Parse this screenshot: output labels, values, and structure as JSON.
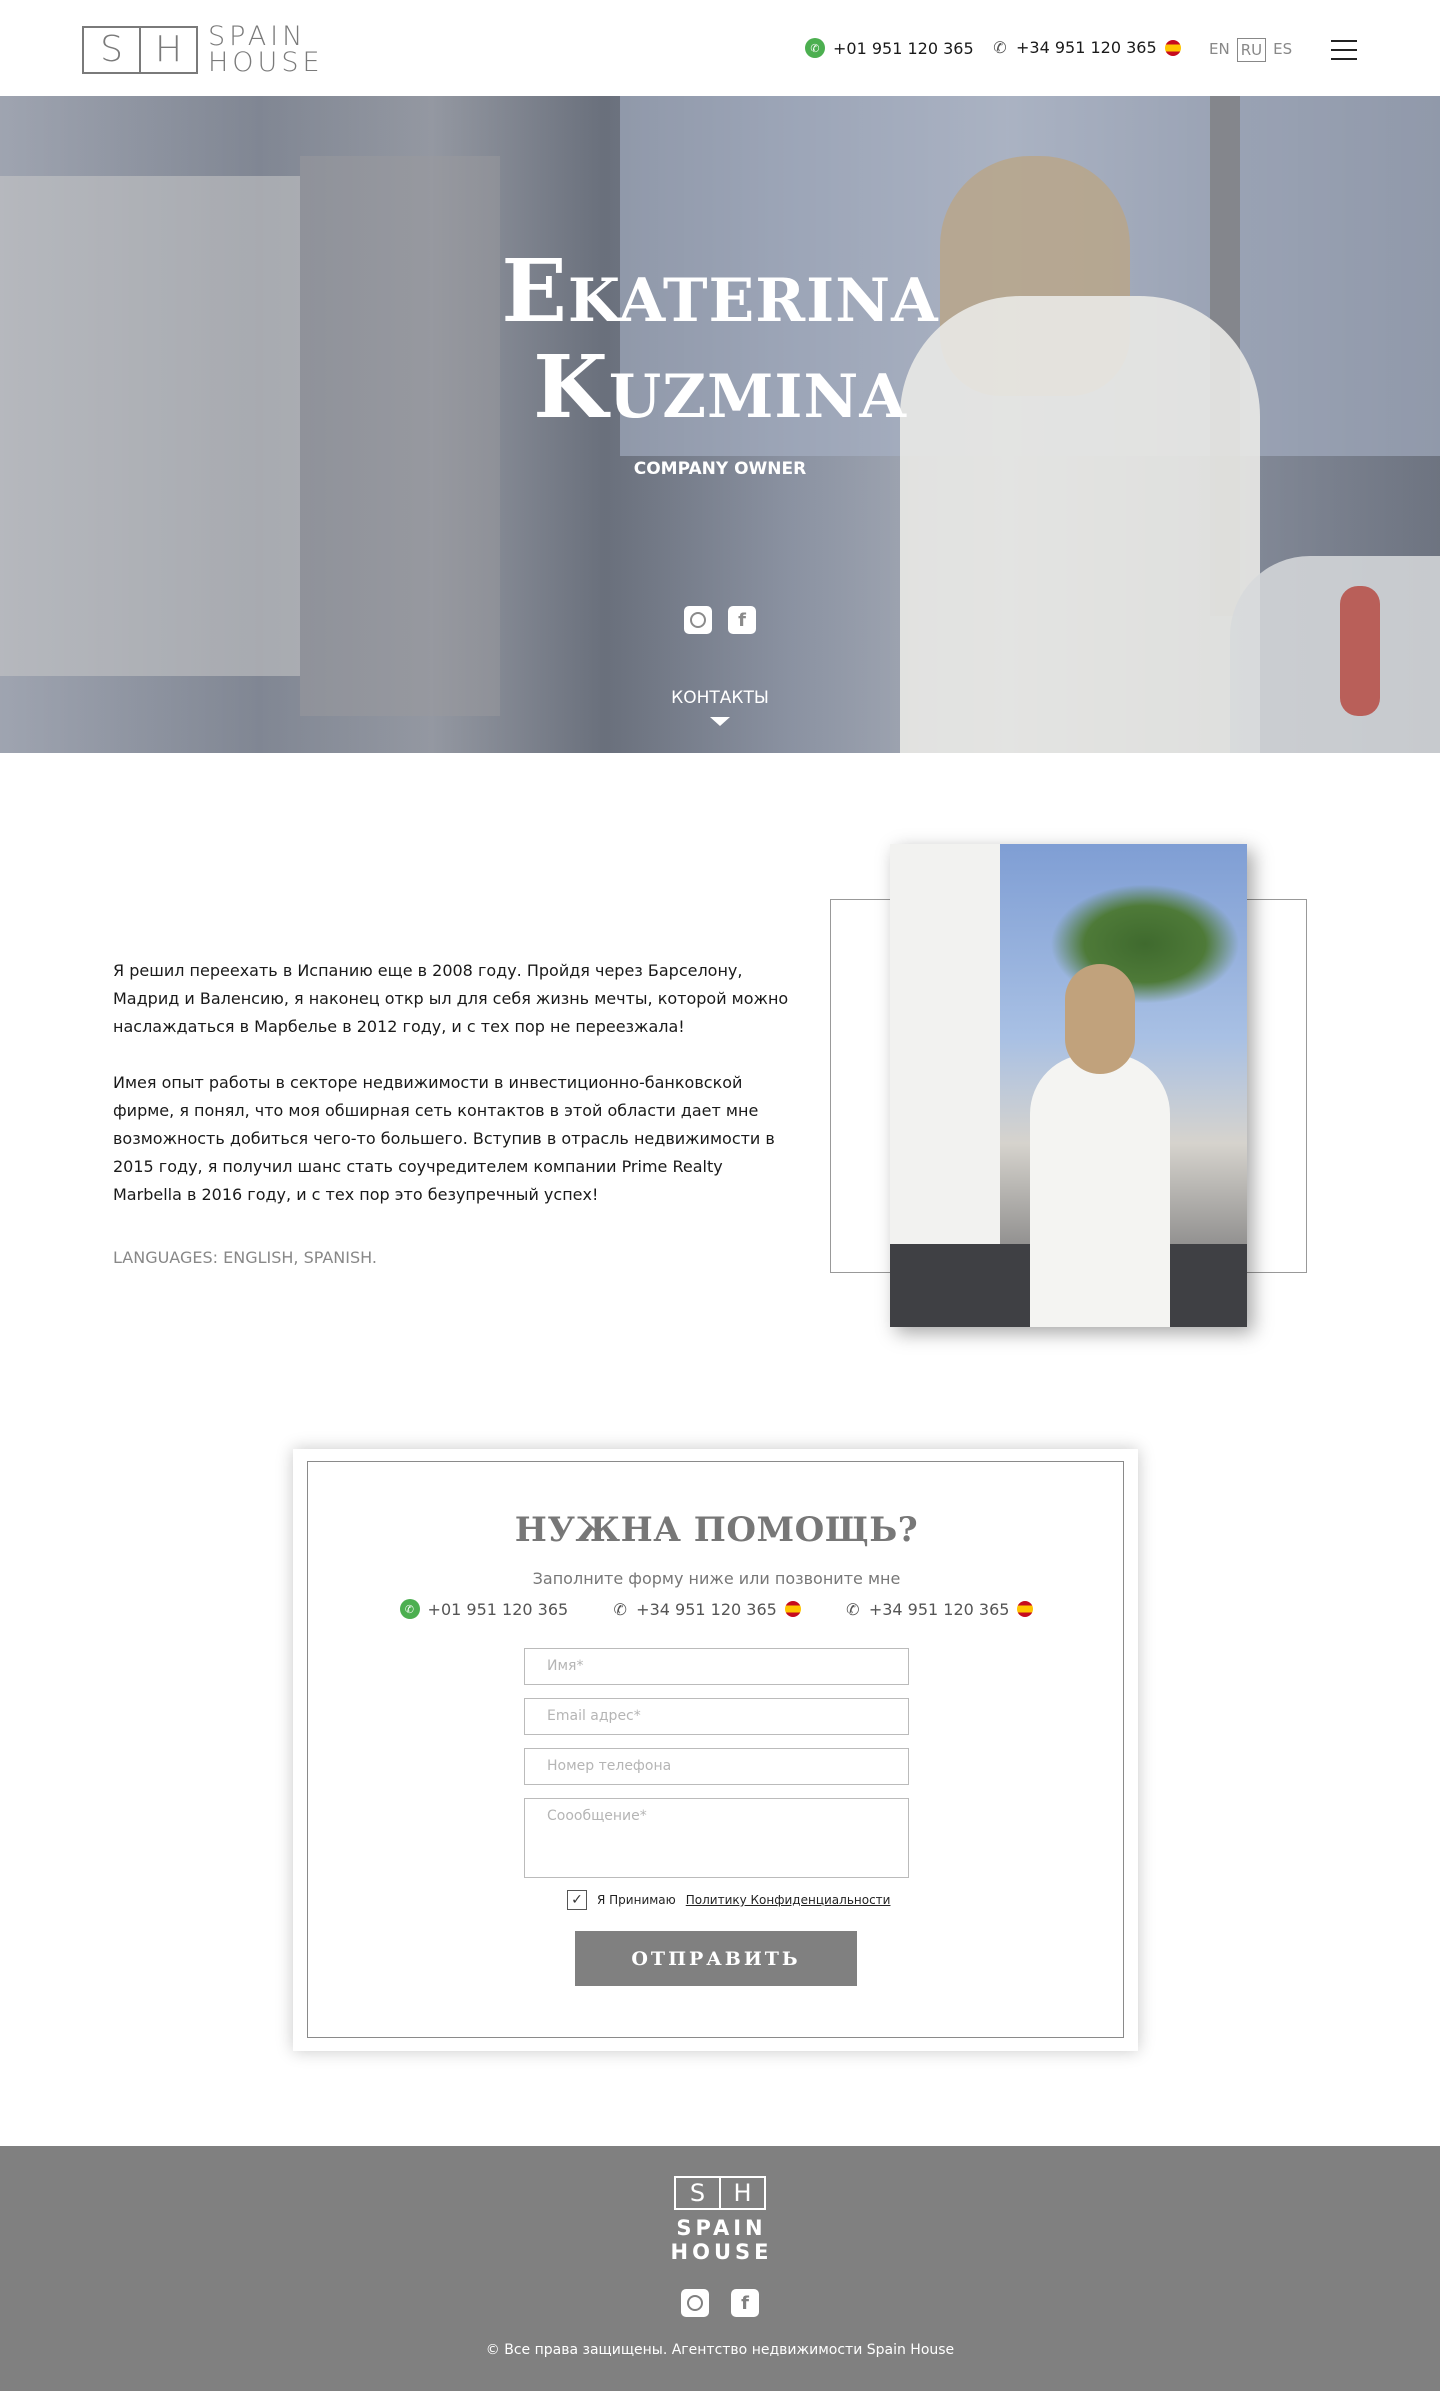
{
  "header": {
    "logo": {
      "letter_left": "S",
      "letter_right": "H",
      "word1": "SPAIN",
      "word2": "HOUSE"
    },
    "phone_whatsapp": "+01 951 120 365",
    "phone_spain": "+34 951 120 365",
    "languages": [
      "EN",
      "RU",
      "ES"
    ],
    "active_language": "RU"
  },
  "hero": {
    "first_name": "Ekaterina",
    "last_name": "Kuzmina",
    "role": "COMPANY OWNER",
    "contacts_label": "КОНТАКТЫ"
  },
  "about": {
    "paragraph1": "Я решил переехать в Испанию еще в 2008 году. Пройдя через Барселону, Мадрид и Валенсию, я наконец откр ыл для себя жизнь мечты, которой можно наслаждаться в Марбелье в 2012 году, и с тех пор не переезжала!",
    "paragraph2": "Имея опыт работы в секторе недвижимости в инвестиционно-банковской фирме, я понял, что моя обширная сеть контактов в этой области дает мне возможность добиться чего-то большего. Вступив в отрасль недвижимости в 2015 году, я получил шанс стать соучредителем компании Prime Realty Marbella в 2016 году, и с тех пор это безупречный успех!",
    "languages": "LANGUAGES: ENGLISH, SPANISH."
  },
  "contact_form": {
    "title": "НУЖНА ПОМОЩЬ?",
    "subtitle": "Заполните форму ниже или позвоните мне",
    "phones": [
      "+01 951 120 365",
      "+34 951 120 365",
      "+34 951 120 365"
    ],
    "name_placeholder": "Имя*",
    "email_placeholder": "Email адрес*",
    "phone_placeholder": "Номер телефона",
    "message_placeholder": "Соообщение*",
    "consent_text": "Я Принимаю",
    "consent_link": "Политику Конфиденциальности",
    "consent_checked": true,
    "submit_label": "ОТПРАВИТЬ"
  },
  "footer": {
    "logo": {
      "letter_left": "S",
      "letter_right": "H",
      "word1": "SPAIN",
      "word2": "HOUSE"
    },
    "copyright": "© Все права защищены. Агентство недвижимости Spain House"
  },
  "icons": {
    "whatsapp": "whatsapp-icon",
    "phone": "phone-icon",
    "flag": "spain-flag-icon",
    "instagram": "instagram-icon",
    "facebook": "facebook-icon",
    "menu": "hamburger-menu-icon",
    "check": "checkmark-icon"
  },
  "colors": {
    "accent_gray": "#808080",
    "whatsapp_green": "#4caf50"
  }
}
